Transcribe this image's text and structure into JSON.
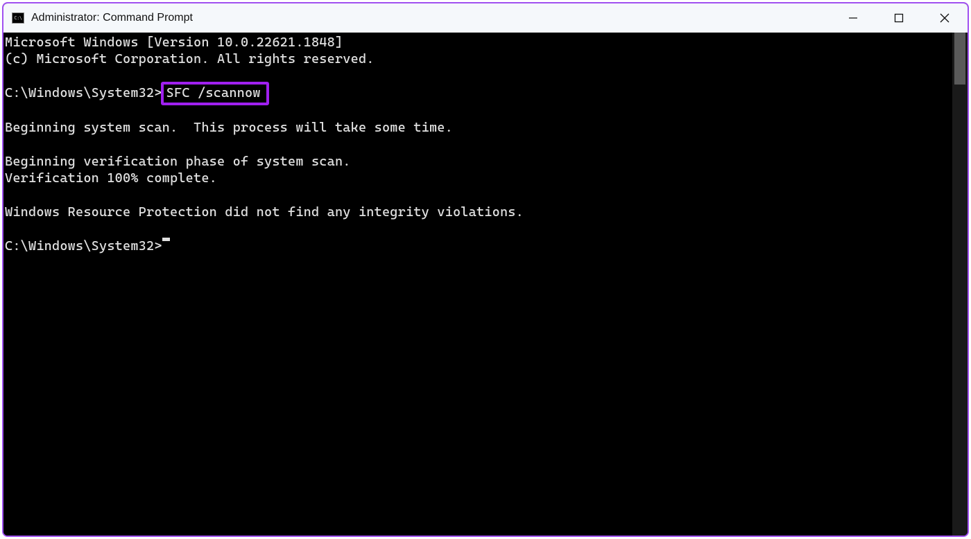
{
  "titlebar": {
    "icon_text": "C:\\",
    "title": "Administrator: Command Prompt"
  },
  "terminal": {
    "line1": "Microsoft Windows [Version 10.0.22621.1848]",
    "line2": "(c) Microsoft Corporation. All rights reserved.",
    "line3": "",
    "prompt1_path": "C:\\Windows\\System32>",
    "prompt1_cmd": "SFC /scannow",
    "line5": "",
    "line6": "Beginning system scan.  This process will take some time.",
    "line7": "",
    "line8": "Beginning verification phase of system scan.",
    "line9": "Verification 100% complete.",
    "line10": "",
    "line11": "Windows Resource Protection did not find any integrity violations.",
    "line12": "",
    "prompt2_path": "C:\\Windows\\System32>"
  },
  "highlight_color": "#a020f0"
}
